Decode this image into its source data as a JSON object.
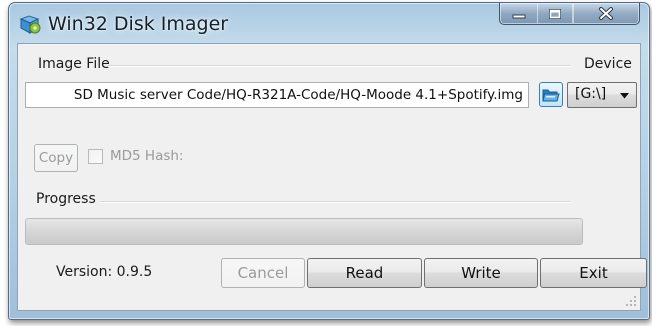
{
  "window": {
    "title": "Win32 Disk Imager",
    "controls": [
      "minimize-icon",
      "maximize-icon",
      "close-icon"
    ]
  },
  "image_file": {
    "label": "Image File",
    "path_value": "SD Music server Code/HQ-R321A-Code/HQ-Moode 4.1+Spotify.img",
    "browse_icon": "folder-open-icon"
  },
  "device": {
    "label": "Device",
    "selected": "[G:\\]"
  },
  "hash": {
    "copy_label": "Copy",
    "md5_label": "MD5 Hash:",
    "md5_checked": false
  },
  "progress": {
    "label": "Progress",
    "value": 0
  },
  "footer": {
    "version": "Version: 0.9.5",
    "cancel_label": "Cancel",
    "read_label": "Read",
    "write_label": "Write",
    "exit_label": "Exit"
  },
  "colors": {
    "frame": "#b3cfe3",
    "client": "#f0f0f0",
    "progress_fill": "#06b025"
  }
}
